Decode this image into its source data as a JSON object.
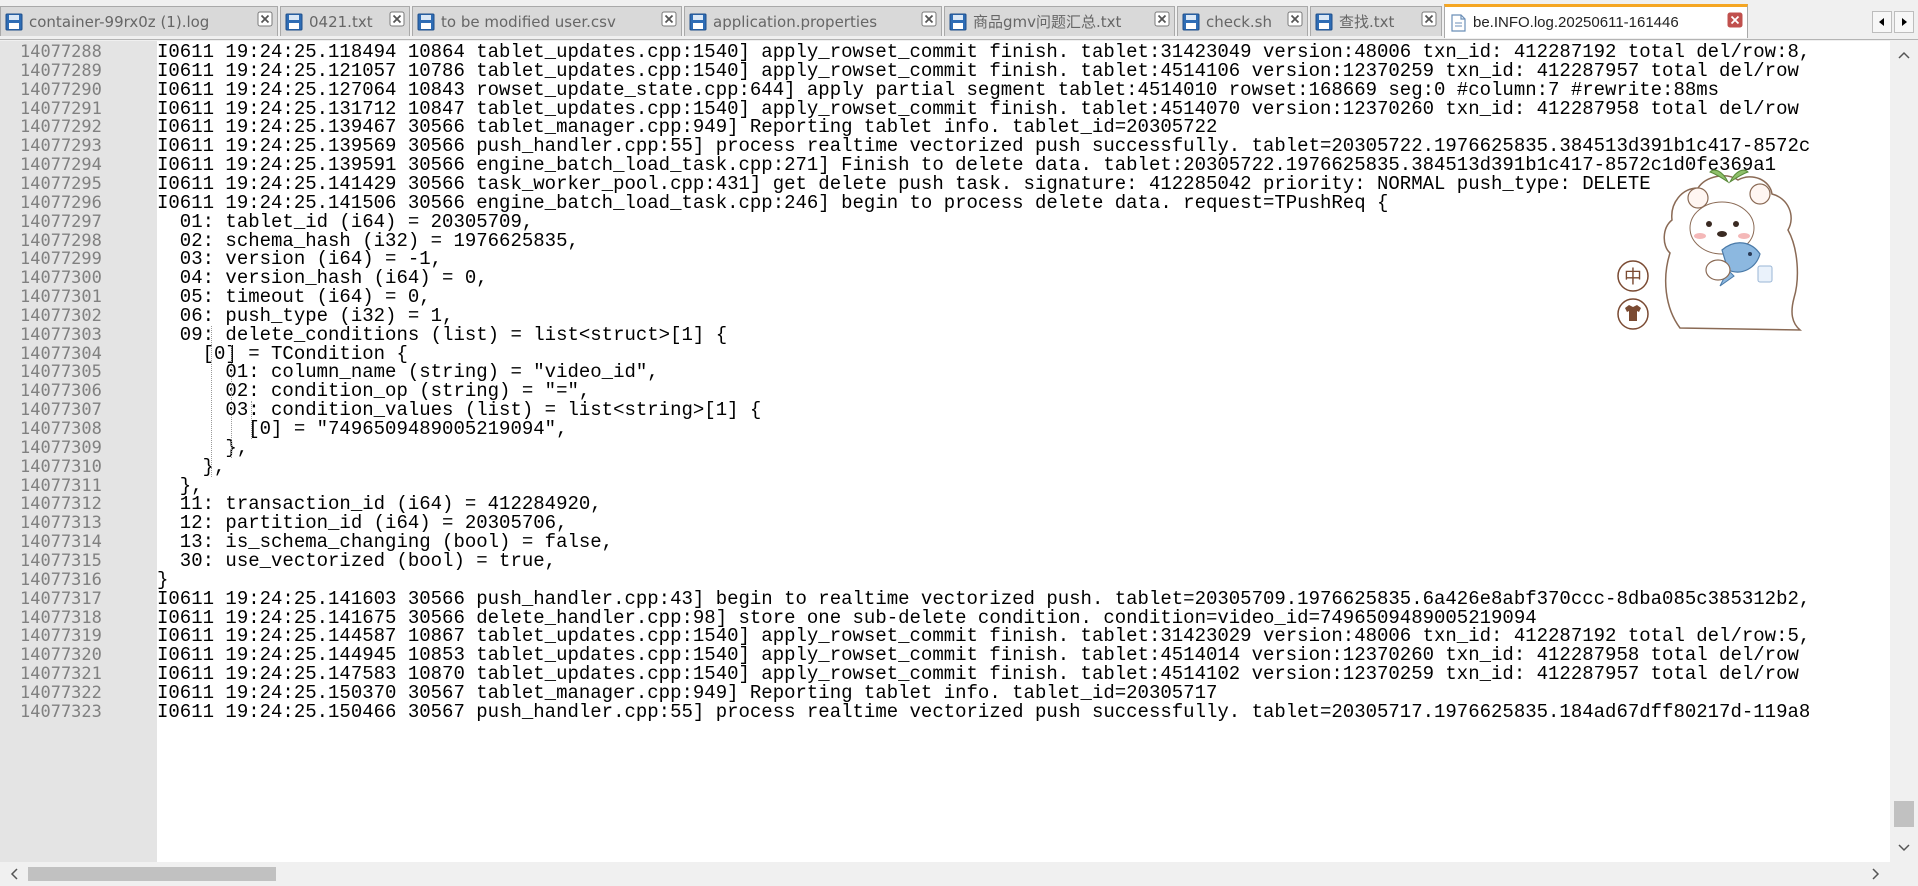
{
  "tabs": [
    {
      "label": "container-99rx0z (1).log",
      "active": false
    },
    {
      "label": "0421.txt",
      "active": false
    },
    {
      "label": "to be modified user.csv",
      "active": false
    },
    {
      "label": "application.properties",
      "active": false
    },
    {
      "label": "商品gmv问题汇总.txt",
      "active": false
    },
    {
      "label": "check.sh",
      "active": false
    },
    {
      "label": "查找.txt",
      "active": false
    },
    {
      "label": "be.INFO.log.20250611-161446",
      "active": true
    }
  ],
  "editor": {
    "lines": [
      {
        "num": "14077288",
        "text": "I0611 19:24:25.118494 10864 tablet_updates.cpp:1540] apply_rowset_commit finish. tablet:31423049 version:48006 txn_id: 412287192 total del/row:8,"
      },
      {
        "num": "14077289",
        "text": "I0611 19:24:25.121057 10786 tablet_updates.cpp:1540] apply_rowset_commit finish. tablet:4514106 version:12370259 txn_id: 412287957 total del/row"
      },
      {
        "num": "14077290",
        "text": "I0611 19:24:25.127064 10843 rowset_update_state.cpp:644] apply partial segment tablet:4514010 rowset:168669 seg:0 #column:7 #rewrite:88ms"
      },
      {
        "num": "14077291",
        "text": "I0611 19:24:25.131712 10847 tablet_updates.cpp:1540] apply_rowset_commit finish. tablet:4514070 version:12370260 txn_id: 412287958 total del/row"
      },
      {
        "num": "14077292",
        "text": "I0611 19:24:25.139467 30566 tablet_manager.cpp:949] Reporting tablet info. tablet_id=20305722"
      },
      {
        "num": "14077293",
        "text": "I0611 19:24:25.139569 30566 push_handler.cpp:55] process realtime vectorized push successfully. tablet=20305722.1976625835.384513d391b1c417-8572c"
      },
      {
        "num": "14077294",
        "text": "I0611 19:24:25.139591 30566 engine_batch_load_task.cpp:271] Finish to delete data. tablet:20305722.1976625835.384513d391b1c417-8572c1d0fe369a1"
      },
      {
        "num": "14077295",
        "text": "I0611 19:24:25.141429 30566 task_worker_pool.cpp:431] get delete push task. signature: 412285042 priority: NORMAL push_type: DELETE"
      },
      {
        "num": "14077296",
        "text": "I0611 19:24:25.141506 30566 engine_batch_load_task.cpp:246] begin to process delete data. request=TPushReq {"
      },
      {
        "num": "14077297",
        "text": "  01: tablet_id (i64) = 20305709,"
      },
      {
        "num": "14077298",
        "text": "  02: schema_hash (i32) = 1976625835,"
      },
      {
        "num": "14077299",
        "text": "  03: version (i64) = -1,"
      },
      {
        "num": "14077300",
        "text": "  04: version_hash (i64) = 0,"
      },
      {
        "num": "14077301",
        "text": "  05: timeout (i64) = 0,"
      },
      {
        "num": "14077302",
        "text": "  06: push_type (i32) = 1,"
      },
      {
        "num": "14077303",
        "text": "  09: delete_conditions (list) = list<struct>[1] {"
      },
      {
        "num": "14077304",
        "text": "    [0] = TCondition {"
      },
      {
        "num": "14077305",
        "text": "      01: column_name (string) = \"video_id\","
      },
      {
        "num": "14077306",
        "text": "      02: condition_op (string) = \"=\","
      },
      {
        "num": "14077307",
        "text": "      03: condition_values (list) = list<string>[1] {"
      },
      {
        "num": "14077308",
        "text": "        [0] = \"7496509489005219094\","
      },
      {
        "num": "14077309",
        "text": "      },"
      },
      {
        "num": "14077310",
        "text": "    },"
      },
      {
        "num": "14077311",
        "text": "  },"
      },
      {
        "num": "14077312",
        "text": "  11: transaction_id (i64) = 412284920,"
      },
      {
        "num": "14077313",
        "text": "  12: partition_id (i64) = 20305706,"
      },
      {
        "num": "14077314",
        "text": "  13: is_schema_changing (bool) = false,"
      },
      {
        "num": "14077315",
        "text": "  30: use_vectorized (bool) = true,"
      },
      {
        "num": "14077316",
        "text": "}"
      },
      {
        "num": "14077317",
        "text": "I0611 19:24:25.141603 30566 push_handler.cpp:43] begin to realtime vectorized push. tablet=20305709.1976625835.6a426e8abf370ccc-8dba085c385312b2,"
      },
      {
        "num": "14077318",
        "text": "I0611 19:24:25.141675 30566 delete_handler.cpp:98] store one sub-delete condition. condition=video_id=7496509489005219094"
      },
      {
        "num": "14077319",
        "text": "I0611 19:24:25.144587 10867 tablet_updates.cpp:1540] apply_rowset_commit finish. tablet:31423029 version:48006 txn_id: 412287192 total del/row:5,"
      },
      {
        "num": "14077320",
        "text": "I0611 19:24:25.144945 10853 tablet_updates.cpp:1540] apply_rowset_commit finish. tablet:4514014 version:12370260 txn_id: 412287958 total del/row"
      },
      {
        "num": "14077321",
        "text": "I0611 19:24:25.147583 10870 tablet_updates.cpp:1540] apply_rowset_commit finish. tablet:4514102 version:12370259 txn_id: 412287957 total del/row"
      },
      {
        "num": "14077322",
        "text": "I0611 19:24:25.150370 30567 tablet_manager.cpp:949] Reporting tablet info. tablet_id=20305717"
      },
      {
        "num": "14077323",
        "text": "I0611 19:24:25.150466 30567 push_handler.cpp:55] process realtime vectorized push successfully. tablet=20305717.1976625835.184ad67dff80217d-119a8"
      }
    ]
  },
  "sticker": {
    "badge_top": "中",
    "badge_bottom": "shirt-icon",
    "mascot": "bear-with-fish-sticker"
  },
  "icons": {
    "file": "floppy-disk-icon",
    "close": "close-x-icon",
    "nav_left": "arrow-left-icon",
    "nav_right": "arrow-right-icon"
  },
  "colors": {
    "active_tab_accent": "#f5a623",
    "close_icon": "#c0504d",
    "gutter": "#e4e4e4",
    "line_number": "#808080"
  }
}
